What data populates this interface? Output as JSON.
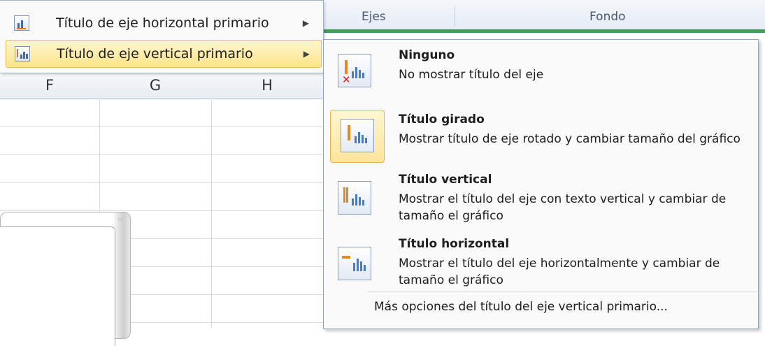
{
  "ribbon": {
    "group_ejes": "Ejes",
    "group_fondo": "Fondo"
  },
  "columns": [
    "F",
    "G",
    "H"
  ],
  "parent_menu": {
    "items": [
      {
        "label": "Título de eje horizontal primario",
        "icon": "axis-title-horizontal-icon",
        "highlighted": false
      },
      {
        "label": "Título de eje vertical primario",
        "icon": "axis-title-vertical-icon",
        "highlighted": true
      }
    ]
  },
  "dropdown": {
    "options": [
      {
        "title": "Ninguno",
        "description": "No mostrar título del eje",
        "icon": "no-title-icon",
        "selected": false
      },
      {
        "title": "Título girado",
        "description": "Mostrar título de eje rotado y cambiar tamaño del gráfico",
        "icon": "rotated-title-icon",
        "selected": true
      },
      {
        "title": "Título vertical",
        "description": "Mostrar el título del eje con texto vertical y cambiar de tamaño el gráfico",
        "icon": "vertical-title-icon",
        "selected": false
      },
      {
        "title": "Título horizontal",
        "description": "Mostrar el título del eje horizontalmente y cambiar de tamaño el gráfico",
        "icon": "horizontal-title-icon",
        "selected": false
      }
    ],
    "more_options": "Más opciones del título del eje vertical primario..."
  },
  "colors": {
    "accent_highlight": "#fde488",
    "ribbon_green": "#3f9e57",
    "icon_orange": "#e08a22",
    "icon_blue": "#4a7bc0"
  }
}
